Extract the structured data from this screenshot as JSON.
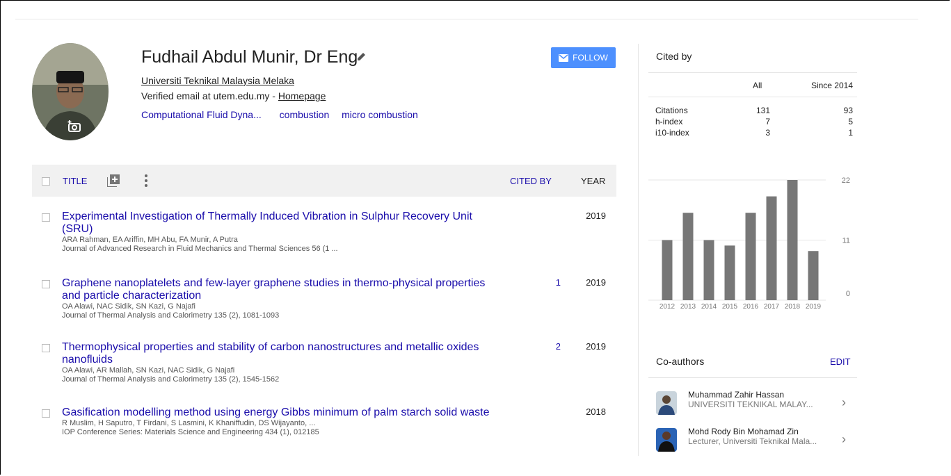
{
  "profile": {
    "name": "Fudhail Abdul Munir, Dr Eng",
    "affiliation": "Universiti Teknikal Malaysia Melaka",
    "email_text": "Verified email at utem.edu.my - ",
    "homepage": "Homepage",
    "interests": [
      "Computational Fluid Dyna...",
      "combustion",
      "micro combustion"
    ],
    "follow_label": "FOLLOW"
  },
  "table": {
    "header": {
      "title": "TITLE",
      "cited_by": "CITED BY",
      "year": "YEAR"
    },
    "rows": [
      {
        "title": "Experimental Investigation of Thermally Induced Vibration in Sulphur Recovery Unit (SRU)",
        "authors": "ARA Rahman, EA Ariffin, MH Abu, FA Munir, A Putra",
        "venue": "Journal of Advanced Research in Fluid Mechanics and Thermal Sciences 56 (1 ...",
        "cited": "",
        "year": "2019"
      },
      {
        "title": "Graphene nanoplatelets and few-layer graphene studies in thermo-physical properties and particle characterization",
        "authors": "OA Alawi, NAC Sidik, SN Kazi, G Najafi",
        "venue": "Journal of Thermal Analysis and Calorimetry 135 (2), 1081-1093",
        "cited": "1",
        "year": "2019"
      },
      {
        "title": "Thermophysical properties and stability of carbon nanostructures and metallic oxides nanofluids",
        "authors": "OA Alawi, AR Mallah, SN Kazi, NAC Sidik, G Najafi",
        "venue": "Journal of Thermal Analysis and Calorimetry 135 (2), 1545-1562",
        "cited": "2",
        "year": "2019"
      },
      {
        "title": "Gasification modelling method using energy Gibbs minimum of palm starch solid waste",
        "authors": "R Muslim, H Saputro, T Firdani, S Lasmini, K Khaniffudin, DS Wijayanto, ...",
        "venue": "IOP Conference Series: Materials Science and Engineering 434 (1), 012185",
        "cited": "",
        "year": "2018"
      }
    ]
  },
  "cited_by": {
    "heading": "Cited by",
    "col_all": "All",
    "col_since": "Since 2014",
    "rows": [
      {
        "label": "Citations",
        "all": "131",
        "since": "93"
      },
      {
        "label": "h-index",
        "all": "7",
        "since": "5"
      },
      {
        "label": "i10-index",
        "all": "3",
        "since": "1"
      }
    ]
  },
  "chart_data": {
    "type": "bar",
    "categories": [
      "2012",
      "2013",
      "2014",
      "2015",
      "2016",
      "2017",
      "2018",
      "2019"
    ],
    "values": [
      11,
      16,
      11,
      10,
      16,
      19,
      22,
      9
    ],
    "yticks": [
      "22",
      "11",
      "0"
    ],
    "ylim": [
      0,
      22
    ],
    "bar_color": "#777777"
  },
  "coauthors": {
    "heading": "Co-authors",
    "edit_label": "EDIT",
    "items": [
      {
        "name": "Muhammad Zahir Hassan",
        "sub": "UNIVERSITI TEKNIKAL MALAY..."
      },
      {
        "name": "Mohd Rody Bin Mohamad Zin",
        "sub": "Lecturer, Universiti Teknikal Mala..."
      }
    ]
  }
}
